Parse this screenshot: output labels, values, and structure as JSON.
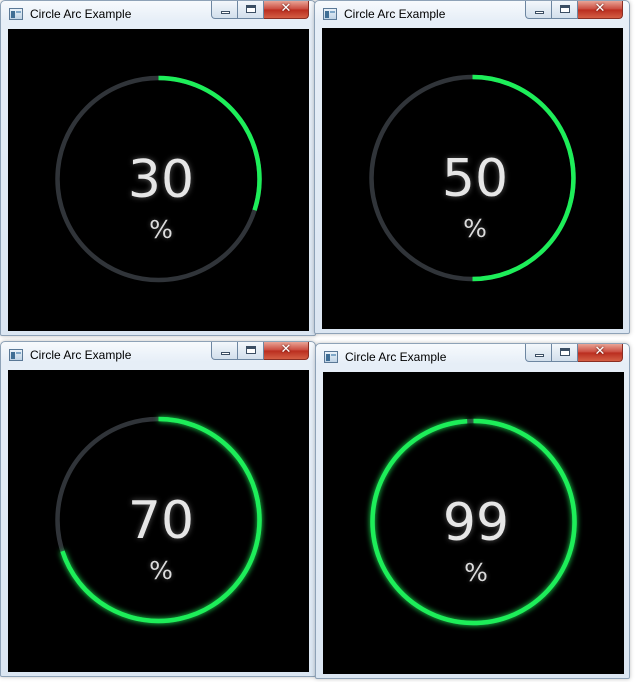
{
  "colors": {
    "arc": "#1dee59",
    "track": "#303439",
    "client_background": "#000000",
    "text": "#e6e6e6"
  },
  "windows": [
    {
      "title": "Circle Arc Example",
      "value": 30,
      "value_label": "30",
      "unit": "%",
      "glow": false
    },
    {
      "title": "Circle Arc Example",
      "value": 50,
      "value_label": "50",
      "unit": "%",
      "glow": false
    },
    {
      "title": "Circle Arc Example",
      "value": 70,
      "value_label": "70",
      "unit": "%",
      "glow": true
    },
    {
      "title": "Circle Arc Example",
      "value": 99,
      "value_label": "99",
      "unit": "%",
      "glow": true
    }
  ],
  "icons": {
    "app": "app-window-icon",
    "minimize": "minimize-icon",
    "maximize": "maximize-icon",
    "close": "close-icon"
  }
}
